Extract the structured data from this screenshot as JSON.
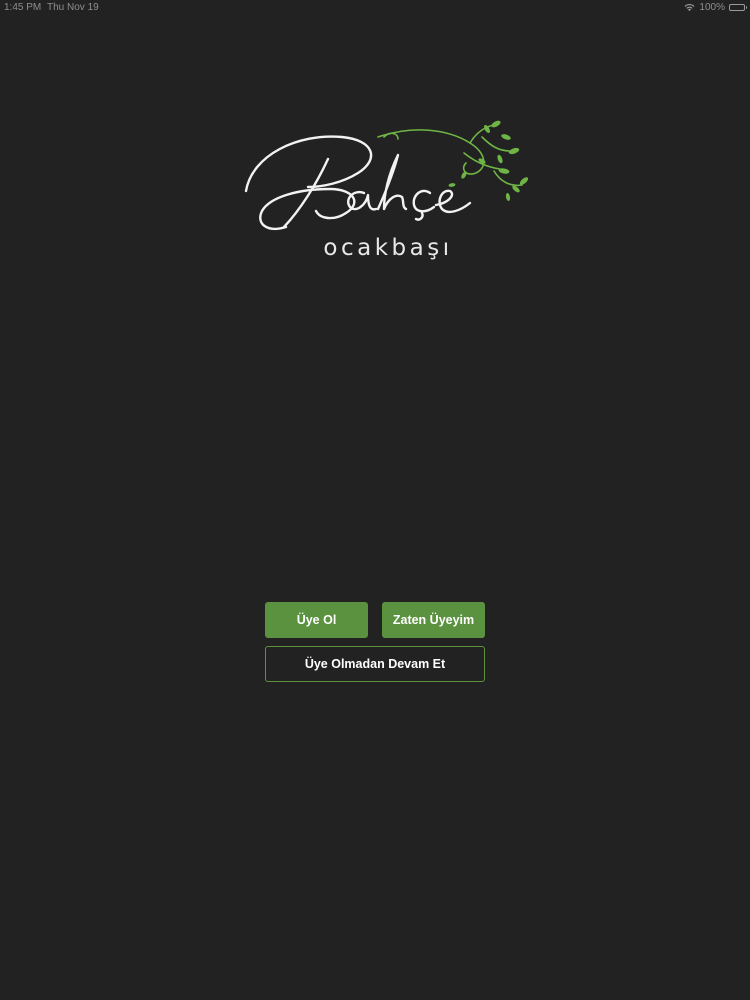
{
  "status_bar": {
    "time": "1:45 PM",
    "date": "Thu Nov 19",
    "battery_text": "100%",
    "wifi_icon": "wifi-icon",
    "battery_icon": "battery-icon"
  },
  "brand": {
    "name": "Bahçe",
    "subtitle": "ocakbaşı",
    "accent_color": "#5b9240",
    "leaf_color": "#6fb545"
  },
  "actions": {
    "register_label": "Üye Ol",
    "login_label": "Zaten Üyeyim",
    "guest_label": "Üye Olmadan Devam Et"
  }
}
